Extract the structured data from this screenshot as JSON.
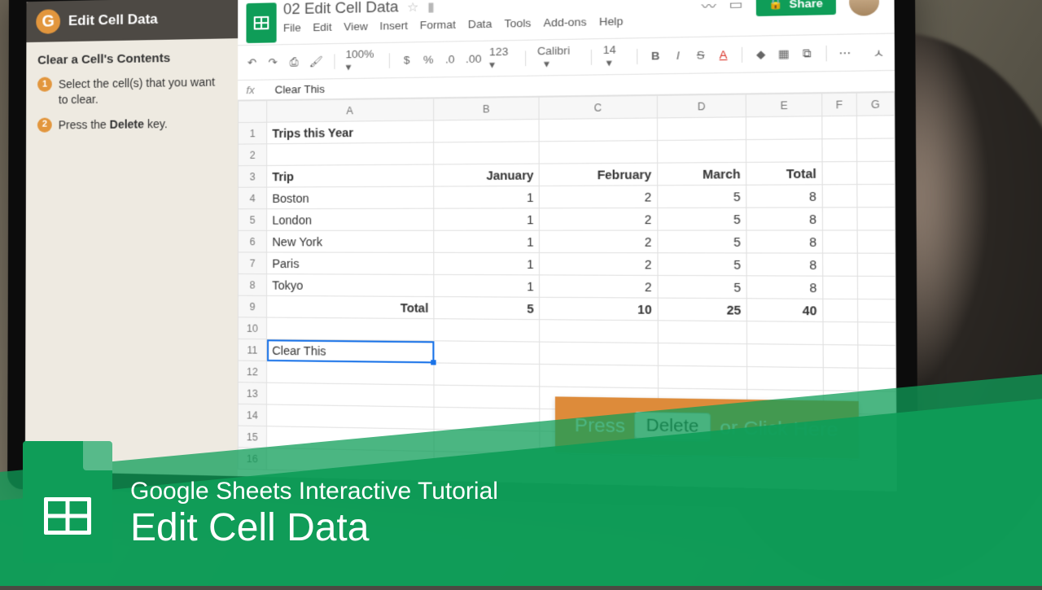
{
  "sidebar": {
    "brand_letter": "G",
    "title": "Edit Cell Data",
    "section": "Clear a Cell's Contents",
    "steps": [
      "Select the cell(s) that you want to clear.",
      "Press the Delete key."
    ]
  },
  "app": {
    "doc_title": "02 Edit Cell Data",
    "menus": [
      "File",
      "Edit",
      "View",
      "Insert",
      "Format",
      "Data",
      "Tools",
      "Add-ons",
      "Help"
    ],
    "share_label": "Share",
    "toolbar": {
      "zoom": "100%",
      "currency": "$",
      "percent": "%",
      "dec_dec": ".0",
      "dec_inc": ".00",
      "numfmt": "123",
      "font": "Calibri",
      "size": "14"
    },
    "fx_value": "Clear This",
    "columns": [
      "A",
      "B",
      "C",
      "D",
      "E",
      "F",
      "G"
    ],
    "row_headers": [
      "1",
      "2",
      "3",
      "4",
      "5",
      "6",
      "7",
      "8",
      "9",
      "10",
      "11",
      "12",
      "13",
      "14",
      "15",
      "16"
    ]
  },
  "chart_data": {
    "type": "table",
    "title": "Trips this Year",
    "columns": [
      "Trip",
      "January",
      "February",
      "March",
      "Total"
    ],
    "rows": [
      {
        "Trip": "Boston",
        "January": 1,
        "February": 2,
        "March": 5,
        "Total": 8
      },
      {
        "Trip": "London",
        "January": 1,
        "February": 2,
        "March": 5,
        "Total": 8
      },
      {
        "Trip": "New York",
        "January": 1,
        "February": 2,
        "March": 5,
        "Total": 8
      },
      {
        "Trip": "Paris",
        "January": 1,
        "February": 2,
        "March": 5,
        "Total": 8
      },
      {
        "Trip": "Tokyo",
        "January": 1,
        "February": 2,
        "March": 5,
        "Total": 8
      }
    ],
    "totals": {
      "Trip": "Total",
      "January": 5,
      "February": 10,
      "March": 25,
      "Total": 40
    },
    "selected_cell": {
      "row": 11,
      "col": "A",
      "value": "Clear This"
    }
  },
  "callout": {
    "before": "Press",
    "key": "Delete",
    "after": "or Click Here"
  },
  "promo": {
    "line1": "Google Sheets Interactive Tutorial",
    "line2": "Edit Cell Data"
  }
}
